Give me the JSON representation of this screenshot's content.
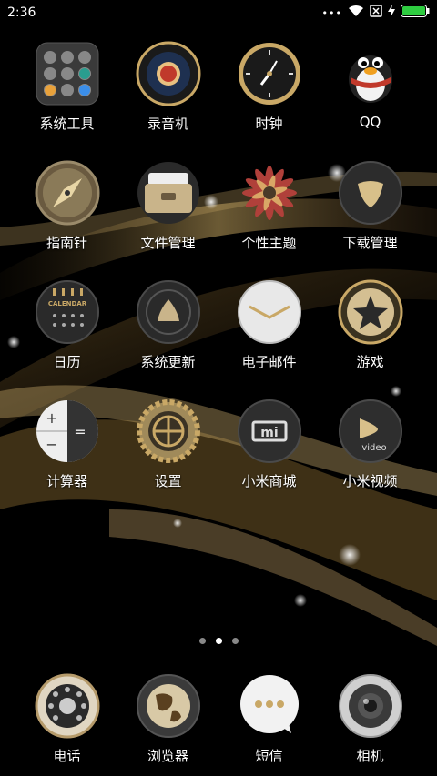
{
  "status": {
    "time": "2:36",
    "more": "•••",
    "icons": [
      "wifi-icon",
      "no-sim-icon",
      "charging-icon",
      "battery-icon"
    ],
    "battery_color": "#2ecc40"
  },
  "apps": [
    {
      "label": "系统工具",
      "icon": "folder-icon"
    },
    {
      "label": "录音机",
      "icon": "recorder-icon"
    },
    {
      "label": "时钟",
      "icon": "clock-icon"
    },
    {
      "label": "QQ",
      "icon": "qq-penguin-icon"
    },
    {
      "label": "指南针",
      "icon": "compass-icon"
    },
    {
      "label": "文件管理",
      "icon": "file-manager-icon"
    },
    {
      "label": "个性主题",
      "icon": "themes-flower-icon"
    },
    {
      "label": "下载管理",
      "icon": "download-icon"
    },
    {
      "label": "日历",
      "icon": "calendar-icon",
      "icon_text": "CALENDAR"
    },
    {
      "label": "系统更新",
      "icon": "system-update-icon"
    },
    {
      "label": "电子邮件",
      "icon": "email-icon"
    },
    {
      "label": "游戏",
      "icon": "games-star-icon"
    },
    {
      "label": "计算器",
      "icon": "calculator-icon"
    },
    {
      "label": "设置",
      "icon": "settings-gear-icon"
    },
    {
      "label": "小米商城",
      "icon": "mi-store-icon",
      "icon_text": "mi"
    },
    {
      "label": "小米视频",
      "icon": "mi-video-icon",
      "icon_text": "video"
    }
  ],
  "pages": {
    "count": 3,
    "active": 2
  },
  "dock": [
    {
      "label": "电话",
      "icon": "phone-dial-icon"
    },
    {
      "label": "浏览器",
      "icon": "browser-globe-icon"
    },
    {
      "label": "短信",
      "icon": "messages-bubble-icon"
    },
    {
      "label": "相机",
      "icon": "camera-lens-icon"
    }
  ],
  "colors": {
    "gold": "#c9a866",
    "dark_gold": "#7a5a28",
    "icon_dark": "#2a2a2a"
  }
}
